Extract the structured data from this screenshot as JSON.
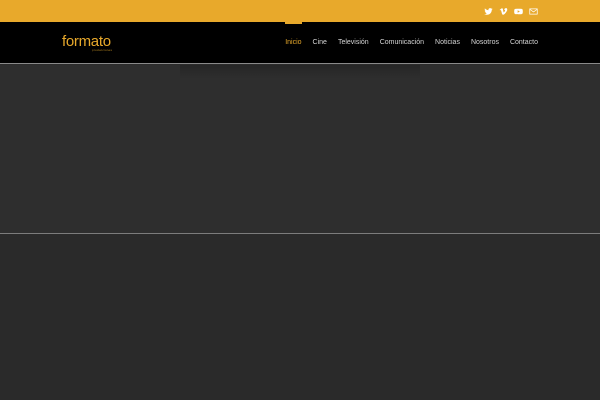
{
  "colors": {
    "accent": "#e8a92b",
    "header_bg": "#000000",
    "page_bg": "#2b2b2b"
  },
  "social": {
    "icons": [
      "twitter-icon",
      "vimeo-icon",
      "youtube-icon",
      "email-icon"
    ]
  },
  "logo": {
    "text": "formato",
    "subtitle": "producciones"
  },
  "nav": {
    "items": [
      {
        "label": "Inicio",
        "active": true
      },
      {
        "label": "Cine",
        "active": false
      },
      {
        "label": "Televisión",
        "active": false
      },
      {
        "label": "Comunicación",
        "active": false
      },
      {
        "label": "Noticias",
        "active": false
      },
      {
        "label": "Nosotros",
        "active": false
      },
      {
        "label": "Contacto",
        "active": false
      }
    ]
  }
}
